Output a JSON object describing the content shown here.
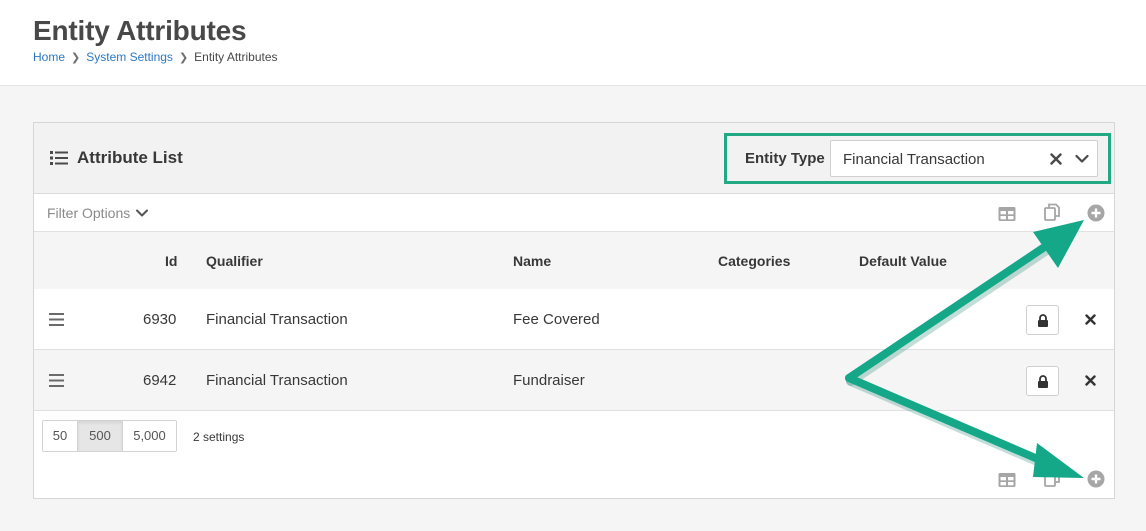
{
  "header": {
    "title": "Entity Attributes",
    "breadcrumb": [
      "Home",
      "System Settings",
      "Entity Attributes"
    ]
  },
  "panel": {
    "title": "Attribute List",
    "entity_type_label": "Entity Type",
    "entity_type_value": "Financial Transaction",
    "filter_label": "Filter Options"
  },
  "table": {
    "columns": [
      "Id",
      "Qualifier",
      "Name",
      "Categories",
      "Default Value"
    ],
    "rows": [
      {
        "id": "6930",
        "qualifier": "Financial Transaction",
        "name": "Fee Covered",
        "categories": "",
        "default_value": ""
      },
      {
        "id": "6942",
        "qualifier": "Financial Transaction",
        "name": "Fundraiser",
        "categories": "",
        "default_value": ""
      }
    ]
  },
  "pager": {
    "sizes": [
      "50",
      "500",
      "5,000"
    ],
    "active": "500",
    "count_text": "2 settings"
  },
  "icons": {
    "list": "list-icon",
    "grid": "grid-icon",
    "copy": "copy-icon",
    "add": "add-circle-icon",
    "lock": "lock-icon",
    "delete": "close-icon",
    "drag": "drag-handle-icon"
  },
  "colors": {
    "highlight": "#22a882",
    "link": "#2b78c2",
    "arrow": "#14a889"
  }
}
